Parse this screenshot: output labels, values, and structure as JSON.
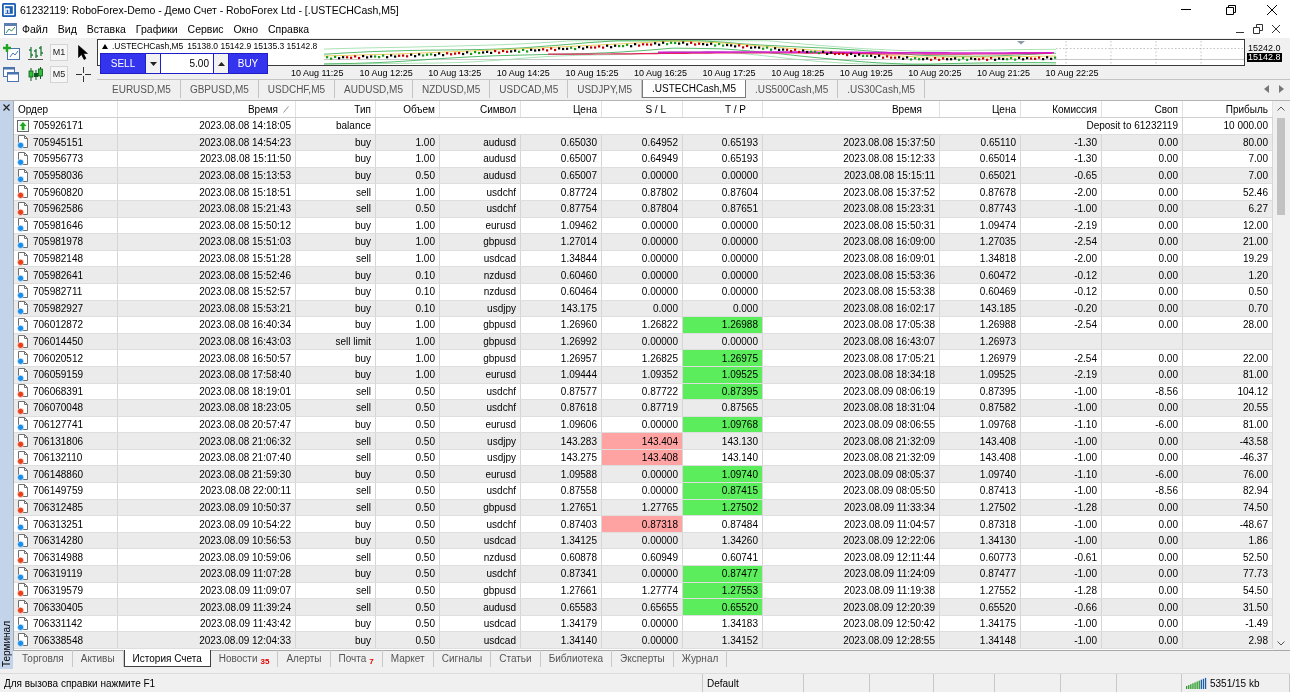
{
  "window": {
    "title": "61232119: RoboForex-Demo - Демо Счет - RoboForex Ltd - [.USTECHCash,M5]"
  },
  "menu": [
    "Файл",
    "Вид",
    "Вставка",
    "Графики",
    "Сервис",
    "Окно",
    "Справка"
  ],
  "toolbar": {
    "timeframes": [
      "M1",
      "M5"
    ]
  },
  "chart": {
    "symbol": ".USTECHCash,M5",
    "quotes": "15138.0 15142.9 15135.3 15142.8",
    "price_labels": [
      {
        "kind": "scale",
        "text": "15242.0"
      },
      {
        "kind": "bid",
        "text": "15142.8"
      }
    ],
    "time_labels": [
      "10 Aug 11:25",
      "10 Aug 12:25",
      "10 Aug 13:25",
      "10 Aug 14:25",
      "10 Aug 15:25",
      "10 Aug 16:25",
      "10 Aug 17:25",
      "10 Aug 18:25",
      "10 Aug 19:25",
      "10 Aug 20:25",
      "10 Aug 21:25",
      "10 Aug 22:25"
    ],
    "trade_panel": {
      "sell": "SELL",
      "lot": "5.00",
      "buy": "BUY"
    }
  },
  "chart_tabs": [
    {
      "label": "EURUSD,M5",
      "selected": false
    },
    {
      "label": "GBPUSD,M5",
      "selected": false
    },
    {
      "label": "USDCHF,M5",
      "selected": false
    },
    {
      "label": "AUDUSD,M5",
      "selected": false
    },
    {
      "label": "NZDUSD,M5",
      "selected": false
    },
    {
      "label": "USDCAD,M5",
      "selected": false
    },
    {
      "label": "USDJPY,M5",
      "selected": false
    },
    {
      "label": ".USTECHCash,M5",
      "selected": true
    },
    {
      "label": ".US500Cash,M5",
      "selected": false
    },
    {
      "label": ".US30Cash,M5",
      "selected": false
    }
  ],
  "terminal": {
    "title": "Терминал"
  },
  "table": {
    "columns": [
      {
        "label": "Ордер",
        "sorted": false
      },
      {
        "label": "Время",
        "sorted": true
      },
      {
        "label": "Тип",
        "sorted": false
      },
      {
        "label": "Объем",
        "sorted": false
      },
      {
        "label": "Символ",
        "sorted": false
      },
      {
        "label": "Цена",
        "sorted": false
      },
      {
        "label": "S / L",
        "sorted": false
      },
      {
        "label": "T / P",
        "sorted": false
      },
      {
        "label": "Время",
        "sorted": false
      },
      {
        "label": "Цена",
        "sorted": false
      },
      {
        "label": "Комиссия",
        "sorted": false
      },
      {
        "label": "Своп",
        "sorted": false
      },
      {
        "label": "Прибыль",
        "sorted": false
      }
    ],
    "balance_row": {
      "order": "705926171",
      "open_time": "2023.08.08 14:18:05",
      "type": "balance",
      "comment": "Deposit to 61232119",
      "profit": "10 000.00"
    },
    "rows": [
      {
        "kind": "buy",
        "order": "705945151",
        "open_time": "2023.08.08 14:54:23",
        "type": "buy",
        "volume": "1.00",
        "symbol": "audusd",
        "open_price": "0.65030",
        "sl": "0.64952",
        "tp": "0.65193",
        "close_time": "2023.08.08 15:37:50",
        "close_price": "0.65110",
        "commission": "-1.30",
        "swap": "0.00",
        "profit": "80.00",
        "sl_hit": false,
        "tp_hit": false
      },
      {
        "kind": "buy",
        "order": "705956773",
        "open_time": "2023.08.08 15:11:50",
        "type": "buy",
        "volume": "1.00",
        "symbol": "audusd",
        "open_price": "0.65007",
        "sl": "0.64949",
        "tp": "0.65193",
        "close_time": "2023.08.08 15:12:33",
        "close_price": "0.65014",
        "commission": "-1.30",
        "swap": "0.00",
        "profit": "7.00",
        "sl_hit": false,
        "tp_hit": false
      },
      {
        "kind": "buy",
        "order": "705958036",
        "open_time": "2023.08.08 15:13:53",
        "type": "buy",
        "volume": "0.50",
        "symbol": "audusd",
        "open_price": "0.65007",
        "sl": "0.00000",
        "tp": "0.00000",
        "close_time": "2023.08.08 15:15:11",
        "close_price": "0.65021",
        "commission": "-0.65",
        "swap": "0.00",
        "profit": "7.00",
        "sl_hit": false,
        "tp_hit": false
      },
      {
        "kind": "sell",
        "order": "705960820",
        "open_time": "2023.08.08 15:18:51",
        "type": "sell",
        "volume": "1.00",
        "symbol": "usdchf",
        "open_price": "0.87724",
        "sl": "0.87802",
        "tp": "0.87604",
        "close_time": "2023.08.08 15:37:52",
        "close_price": "0.87678",
        "commission": "-2.00",
        "swap": "0.00",
        "profit": "52.46",
        "sl_hit": false,
        "tp_hit": false
      },
      {
        "kind": "sell",
        "order": "705962586",
        "open_time": "2023.08.08 15:21:43",
        "type": "sell",
        "volume": "0.50",
        "symbol": "usdchf",
        "open_price": "0.87754",
        "sl": "0.87804",
        "tp": "0.87651",
        "close_time": "2023.08.08 15:23:31",
        "close_price": "0.87743",
        "commission": "-1.00",
        "swap": "0.00",
        "profit": "6.27",
        "sl_hit": false,
        "tp_hit": false
      },
      {
        "kind": "buy",
        "order": "705981646",
        "open_time": "2023.08.08 15:50:12",
        "type": "buy",
        "volume": "1.00",
        "symbol": "eurusd",
        "open_price": "1.09462",
        "sl": "0.00000",
        "tp": "0.00000",
        "close_time": "2023.08.08 15:50:31",
        "close_price": "1.09474",
        "commission": "-2.19",
        "swap": "0.00",
        "profit": "12.00",
        "sl_hit": false,
        "tp_hit": false
      },
      {
        "kind": "buy",
        "order": "705981978",
        "open_time": "2023.08.08 15:51:03",
        "type": "buy",
        "volume": "1.00",
        "symbol": "gbpusd",
        "open_price": "1.27014",
        "sl": "0.00000",
        "tp": "0.00000",
        "close_time": "2023.08.08 16:09:00",
        "close_price": "1.27035",
        "commission": "-2.54",
        "swap": "0.00",
        "profit": "21.00",
        "sl_hit": false,
        "tp_hit": false
      },
      {
        "kind": "sell",
        "order": "705982148",
        "open_time": "2023.08.08 15:51:28",
        "type": "sell",
        "volume": "1.00",
        "symbol": "usdcad",
        "open_price": "1.34844",
        "sl": "0.00000",
        "tp": "0.00000",
        "close_time": "2023.08.08 16:09:01",
        "close_price": "1.34818",
        "commission": "-2.00",
        "swap": "0.00",
        "profit": "19.29",
        "sl_hit": false,
        "tp_hit": false
      },
      {
        "kind": "buy",
        "order": "705982641",
        "open_time": "2023.08.08 15:52:46",
        "type": "buy",
        "volume": "0.10",
        "symbol": "nzdusd",
        "open_price": "0.60460",
        "sl": "0.00000",
        "tp": "0.00000",
        "close_time": "2023.08.08 15:53:36",
        "close_price": "0.60472",
        "commission": "-0.12",
        "swap": "0.00",
        "profit": "1.20",
        "sl_hit": false,
        "tp_hit": false
      },
      {
        "kind": "buy",
        "order": "705982711",
        "open_time": "2023.08.08 15:52:57",
        "type": "buy",
        "volume": "0.10",
        "symbol": "nzdusd",
        "open_price": "0.60464",
        "sl": "0.00000",
        "tp": "0.00000",
        "close_time": "2023.08.08 15:53:38",
        "close_price": "0.60469",
        "commission": "-0.12",
        "swap": "0.00",
        "profit": "0.50",
        "sl_hit": false,
        "tp_hit": false
      },
      {
        "kind": "buy",
        "order": "705982927",
        "open_time": "2023.08.08 15:53:21",
        "type": "buy",
        "volume": "0.10",
        "symbol": "usdjpy",
        "open_price": "143.175",
        "sl": "0.000",
        "tp": "0.000",
        "close_time": "2023.08.08 16:02:17",
        "close_price": "143.185",
        "commission": "-0.20",
        "swap": "0.00",
        "profit": "0.70",
        "sl_hit": false,
        "tp_hit": false
      },
      {
        "kind": "buy",
        "order": "706012872",
        "open_time": "2023.08.08 16:40:34",
        "type": "buy",
        "volume": "1.00",
        "symbol": "gbpusd",
        "open_price": "1.26960",
        "sl": "1.26822",
        "tp": "1.26988",
        "close_time": "2023.08.08 17:05:38",
        "close_price": "1.26988",
        "commission": "-2.54",
        "swap": "0.00",
        "profit": "28.00",
        "sl_hit": false,
        "tp_hit": true
      },
      {
        "kind": "sell",
        "order": "706014450",
        "open_time": "2023.08.08 16:43:03",
        "type": "sell limit",
        "volume": "1.00",
        "symbol": "gbpusd",
        "open_price": "1.26992",
        "sl": "0.00000",
        "tp": "0.00000",
        "close_time": "2023.08.08 16:43:07",
        "close_price": "1.26973",
        "sl_hit": false,
        "tp_hit": false
      },
      {
        "kind": "buy",
        "order": "706020512",
        "open_time": "2023.08.08 16:50:57",
        "type": "buy",
        "volume": "1.00",
        "symbol": "gbpusd",
        "open_price": "1.26957",
        "sl": "1.26825",
        "tp": "1.26975",
        "close_time": "2023.08.08 17:05:21",
        "close_price": "1.26979",
        "commission": "-2.54",
        "swap": "0.00",
        "profit": "22.00",
        "sl_hit": false,
        "tp_hit": true
      },
      {
        "kind": "buy",
        "order": "706059159",
        "open_time": "2023.08.08 17:58:40",
        "type": "buy",
        "volume": "1.00",
        "symbol": "eurusd",
        "open_price": "1.09444",
        "sl": "1.09352",
        "tp": "1.09525",
        "close_time": "2023.08.08 18:34:18",
        "close_price": "1.09525",
        "commission": "-2.19",
        "swap": "0.00",
        "profit": "81.00",
        "sl_hit": false,
        "tp_hit": true
      },
      {
        "kind": "sell",
        "order": "706068391",
        "open_time": "2023.08.08 18:19:01",
        "type": "sell",
        "volume": "0.50",
        "symbol": "usdchf",
        "open_price": "0.87577",
        "sl": "0.87722",
        "tp": "0.87395",
        "close_time": "2023.08.09 08:06:19",
        "close_price": "0.87395",
        "commission": "-1.00",
        "swap": "-8.56",
        "profit": "104.12",
        "sl_hit": false,
        "tp_hit": true
      },
      {
        "kind": "sell",
        "order": "706070048",
        "open_time": "2023.08.08 18:23:05",
        "type": "sell",
        "volume": "0.50",
        "symbol": "usdchf",
        "open_price": "0.87618",
        "sl": "0.87719",
        "tp": "0.87565",
        "close_time": "2023.08.08 18:31:04",
        "close_price": "0.87582",
        "commission": "-1.00",
        "swap": "0.00",
        "profit": "20.55",
        "sl_hit": false,
        "tp_hit": false
      },
      {
        "kind": "buy",
        "order": "706127741",
        "open_time": "2023.08.08 20:57:47",
        "type": "buy",
        "volume": "0.50",
        "symbol": "eurusd",
        "open_price": "1.09606",
        "sl": "0.00000",
        "tp": "1.09768",
        "close_time": "2023.08.09 08:06:55",
        "close_price": "1.09768",
        "commission": "-1.10",
        "swap": "-6.00",
        "profit": "81.00",
        "sl_hit": false,
        "tp_hit": true
      },
      {
        "kind": "sell",
        "order": "706131806",
        "open_time": "2023.08.08 21:06:32",
        "type": "sell",
        "volume": "0.50",
        "symbol": "usdjpy",
        "open_price": "143.283",
        "sl": "143.404",
        "tp": "143.130",
        "close_time": "2023.08.08 21:32:09",
        "close_price": "143.408",
        "commission": "-1.00",
        "swap": "0.00",
        "profit": "-43.58",
        "sl_hit": true,
        "tp_hit": false
      },
      {
        "kind": "sell",
        "order": "706132110",
        "open_time": "2023.08.08 21:07:40",
        "type": "sell",
        "volume": "0.50",
        "symbol": "usdjpy",
        "open_price": "143.275",
        "sl": "143.408",
        "tp": "143.140",
        "close_time": "2023.08.08 21:32:09",
        "close_price": "143.408",
        "commission": "-1.00",
        "swap": "0.00",
        "profit": "-46.37",
        "sl_hit": true,
        "tp_hit": false
      },
      {
        "kind": "buy",
        "order": "706148860",
        "open_time": "2023.08.08 21:59:30",
        "type": "buy",
        "volume": "0.50",
        "symbol": "eurusd",
        "open_price": "1.09588",
        "sl": "0.00000",
        "tp": "1.09740",
        "close_time": "2023.08.09 08:05:37",
        "close_price": "1.09740",
        "commission": "-1.10",
        "swap": "-6.00",
        "profit": "76.00",
        "sl_hit": false,
        "tp_hit": true
      },
      {
        "kind": "sell",
        "order": "706149759",
        "open_time": "2023.08.08 22:00:11",
        "type": "sell",
        "volume": "0.50",
        "symbol": "usdchf",
        "open_price": "0.87558",
        "sl": "0.00000",
        "tp": "0.87415",
        "close_time": "2023.08.09 08:05:50",
        "close_price": "0.87413",
        "commission": "-1.00",
        "swap": "-8.56",
        "profit": "82.94",
        "sl_hit": false,
        "tp_hit": true
      },
      {
        "kind": "sell",
        "order": "706312485",
        "open_time": "2023.08.09 10:50:37",
        "type": "sell",
        "volume": "0.50",
        "symbol": "gbpusd",
        "open_price": "1.27651",
        "sl": "1.27765",
        "tp": "1.27502",
        "close_time": "2023.08.09 11:33:34",
        "close_price": "1.27502",
        "commission": "-1.28",
        "swap": "0.00",
        "profit": "74.50",
        "sl_hit": false,
        "tp_hit": true
      },
      {
        "kind": "buy",
        "order": "706313251",
        "open_time": "2023.08.09 10:54:22",
        "type": "buy",
        "volume": "0.50",
        "symbol": "usdchf",
        "open_price": "0.87403",
        "sl": "0.87318",
        "tp": "0.87484",
        "close_time": "2023.08.09 11:04:57",
        "close_price": "0.87318",
        "commission": "-1.00",
        "swap": "0.00",
        "profit": "-48.67",
        "sl_hit": true,
        "tp_hit": false
      },
      {
        "kind": "buy",
        "order": "706314280",
        "open_time": "2023.08.09 10:56:53",
        "type": "buy",
        "volume": "0.50",
        "symbol": "usdcad",
        "open_price": "1.34125",
        "sl": "0.00000",
        "tp": "1.34260",
        "close_time": "2023.08.09 12:22:06",
        "close_price": "1.34130",
        "commission": "-1.00",
        "swap": "0.00",
        "profit": "1.86",
        "sl_hit": false,
        "tp_hit": false
      },
      {
        "kind": "sell",
        "order": "706314988",
        "open_time": "2023.08.09 10:59:06",
        "type": "sell",
        "volume": "0.50",
        "symbol": "nzdusd",
        "open_price": "0.60878",
        "sl": "0.60949",
        "tp": "0.60741",
        "close_time": "2023.08.09 12:11:44",
        "close_price": "0.60773",
        "commission": "-0.61",
        "swap": "0.00",
        "profit": "52.50",
        "sl_hit": false,
        "tp_hit": false
      },
      {
        "kind": "buy",
        "order": "706319119",
        "open_time": "2023.08.09 11:07:28",
        "type": "buy",
        "volume": "0.50",
        "symbol": "usdchf",
        "open_price": "0.87341",
        "sl": "0.00000",
        "tp": "0.87477",
        "close_time": "2023.08.09 11:24:09",
        "close_price": "0.87477",
        "commission": "-1.00",
        "swap": "0.00",
        "profit": "77.73",
        "sl_hit": false,
        "tp_hit": true
      },
      {
        "kind": "sell",
        "order": "706319579",
        "open_time": "2023.08.09 11:09:07",
        "type": "sell",
        "volume": "0.50",
        "symbol": "gbpusd",
        "open_price": "1.27661",
        "sl": "1.27774",
        "tp": "1.27553",
        "close_time": "2023.08.09 11:19:38",
        "close_price": "1.27552",
        "commission": "-1.28",
        "swap": "0.00",
        "profit": "54.50",
        "sl_hit": false,
        "tp_hit": true
      },
      {
        "kind": "sell",
        "order": "706330405",
        "open_time": "2023.08.09 11:39:24",
        "type": "sell",
        "volume": "0.50",
        "symbol": "audusd",
        "open_price": "0.65583",
        "sl": "0.65655",
        "tp": "0.65520",
        "close_time": "2023.08.09 12:20:39",
        "close_price": "0.65520",
        "commission": "-0.66",
        "swap": "0.00",
        "profit": "31.50",
        "sl_hit": false,
        "tp_hit": true
      },
      {
        "kind": "buy",
        "order": "706331142",
        "open_time": "2023.08.09 11:43:42",
        "type": "buy",
        "volume": "0.50",
        "symbol": "usdcad",
        "open_price": "1.34179",
        "sl": "0.00000",
        "tp": "1.34183",
        "close_time": "2023.08.09 12:50:42",
        "close_price": "1.34175",
        "commission": "-1.00",
        "swap": "0.00",
        "profit": "-1.49",
        "sl_hit": false,
        "tp_hit": false
      },
      {
        "kind": "buy",
        "order": "706338548",
        "open_time": "2023.08.09 12:04:33",
        "type": "buy",
        "volume": "0.50",
        "symbol": "usdcad",
        "open_price": "1.34140",
        "sl": "0.00000",
        "tp": "1.34152",
        "close_time": "2023.08.09 12:28:55",
        "close_price": "1.34148",
        "commission": "-1.00",
        "swap": "0.00",
        "profit": "2.98",
        "sl_hit": false,
        "tp_hit": false
      }
    ]
  },
  "terminal_tabs": [
    {
      "label": "Торговля",
      "selected": false
    },
    {
      "label": "Активы",
      "selected": false
    },
    {
      "label": "История Счета",
      "selected": true
    },
    {
      "label": "Новости",
      "count": "35",
      "selected": false
    },
    {
      "label": "Алерты",
      "selected": false
    },
    {
      "label": "Почта",
      "count": "7",
      "selected": false
    },
    {
      "label": "Маркет",
      "selected": false
    },
    {
      "label": "Сигналы",
      "selected": false
    },
    {
      "label": "Статьи",
      "selected": false
    },
    {
      "label": "Библиотека",
      "selected": false
    },
    {
      "label": "Эксперты",
      "selected": false
    },
    {
      "label": "Журнал",
      "selected": false
    }
  ],
  "status_bar": {
    "help": "Для вызова справки нажмите F1",
    "profile": "Default",
    "traffic": "5351/15 kb"
  }
}
